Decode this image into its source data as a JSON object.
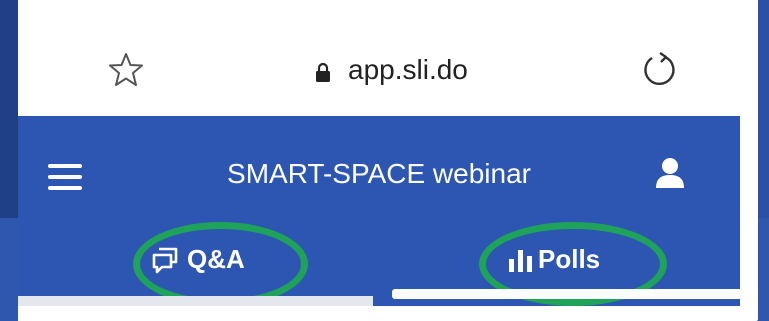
{
  "browser": {
    "url": "app.sli.do",
    "icons": {
      "bookmark": "star-icon",
      "secure": "lock-icon",
      "reload": "reload-icon"
    }
  },
  "app": {
    "title": "SMART-SPACE webinar",
    "header_color": "#2c56b1",
    "icons": {
      "menu": "menu-icon",
      "profile": "user-icon"
    }
  },
  "tabs": [
    {
      "label": "Q&A",
      "icon": "chat-icon",
      "selected": false
    },
    {
      "label": "Polls",
      "icon": "bars-icon",
      "selected": true
    }
  ],
  "annotation": {
    "highlight_color": "#1fa35b"
  }
}
